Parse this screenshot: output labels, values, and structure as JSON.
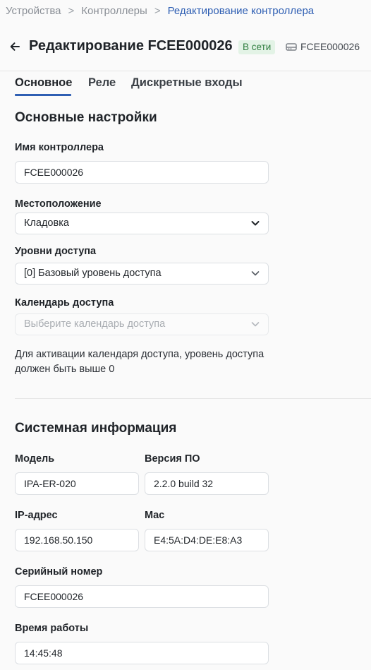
{
  "breadcrumb": {
    "items": [
      "Устройства",
      "Контроллеры",
      "Редактирование контроллера"
    ],
    "separator": ">"
  },
  "header": {
    "title": "Редактирование FCEE000026",
    "status": "В сети",
    "device_id": "FCEE000026",
    "back_icon": "arrow-left-icon",
    "device_icon": "controller-icon"
  },
  "tabs": [
    "Основное",
    "Реле",
    "Дискретные входы"
  ],
  "basic": {
    "title": "Основные настройки",
    "name_label": "Имя контроллера",
    "name_value": "FCEE000026",
    "location_label": "Местоположение",
    "location_value": "Кладовка",
    "access_levels_label": "Уровни доступа",
    "access_levels_value": "[0] Базовый уровень доступа",
    "calendar_label": "Календарь доступа",
    "calendar_placeholder": "Выберите календарь доступа",
    "calendar_hint": "Для активации календаря доступа, уровень доступа должен быть выше 0"
  },
  "system": {
    "title": "Системная информация",
    "model_label": "Модель",
    "model_value": "IPA-ER-020",
    "firmware_label": "Версия ПО",
    "firmware_value": "2.2.0 build 32",
    "ip_label": "IP-адрес",
    "ip_value": "192.168.50.150",
    "mac_label": "Mac",
    "mac_value": "E4:5A:D4:DE:E8:A3",
    "serial_label": "Серийный номер",
    "serial_value": "FCEE000026",
    "uptime_label": "Время работы",
    "uptime_value": "14:45:48"
  },
  "colors": {
    "accent": "#2f5fb3",
    "status_bg": "#e3f3e6",
    "status_text": "#2e7d3e"
  }
}
